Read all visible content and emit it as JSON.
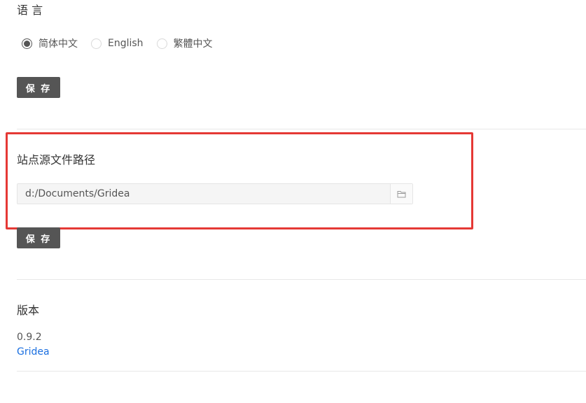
{
  "language": {
    "title": "语 言",
    "options": [
      {
        "label": "简体中文",
        "checked": true
      },
      {
        "label": "English",
        "checked": false
      },
      {
        "label": "繁體中文",
        "checked": false
      }
    ],
    "save_label": "保 存"
  },
  "source_path": {
    "title": "站点源文件路径",
    "value": "d:/Documents/Gridea",
    "folder_icon": "folder-icon",
    "save_label": "保 存"
  },
  "version": {
    "title": "版本",
    "number": "0.9.2",
    "link_label": "Gridea"
  },
  "colors": {
    "highlight": "#e53935",
    "button": "#555555",
    "link": "#1a6fe0"
  }
}
